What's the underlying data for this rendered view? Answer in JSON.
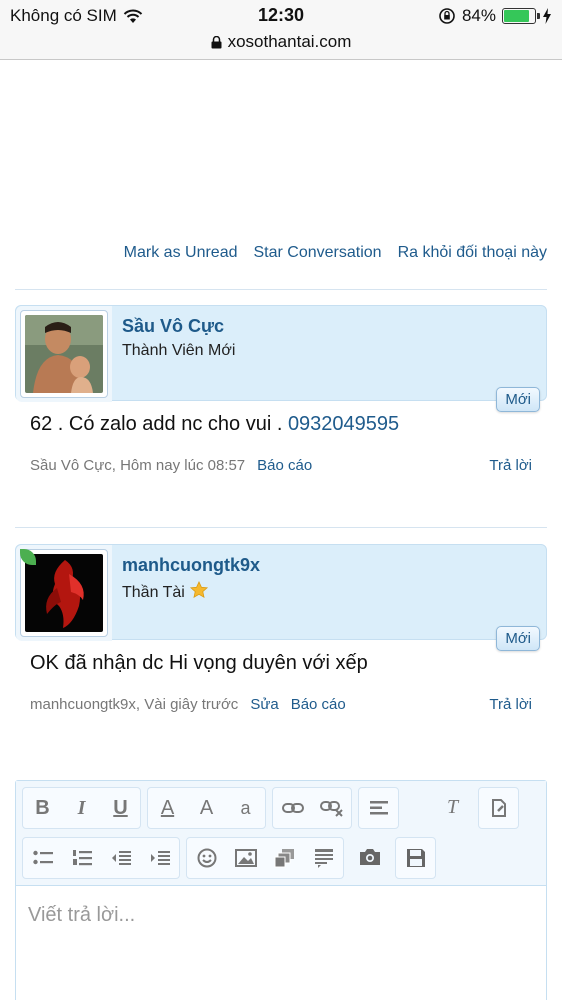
{
  "status_bar": {
    "carrier": "Không có SIM",
    "time": "12:30",
    "battery": "84%",
    "battery_level": 0.84
  },
  "url_bar": {
    "domain": "xosothantai.com"
  },
  "conversation_actions": {
    "mark_unread": "Mark as Unread",
    "star": "Star Conversation",
    "leave": "Ra khỏi đối thoại này"
  },
  "messages": [
    {
      "username": "Sầu Vô Cực",
      "user_title": "Thành Viên Mới",
      "badge": "Mới",
      "text": "62 . Có zalo add nc cho vui . ",
      "phone": "0932049595",
      "meta": "Sầu Vô Cực, Hôm nay lúc 08:57",
      "report": "Báo cáo",
      "reply": "Trả lời"
    },
    {
      "username": "manhcuongtk9x",
      "user_title": "Thần Tài",
      "badge": "Mới",
      "text": "OK đã nhận dc Hi vọng duyên với xếp",
      "meta": "manhcuongtk9x, Vài giây trước",
      "edit": "Sửa",
      "report": "Báo cáo",
      "reply": "Trả lời"
    }
  ],
  "editor": {
    "placeholder": "Viết trả lời...",
    "bold": "B",
    "italic": "I",
    "underline": "U",
    "font_color": "A",
    "font_size": "A",
    "font_family": "a",
    "clear_format": "T"
  }
}
